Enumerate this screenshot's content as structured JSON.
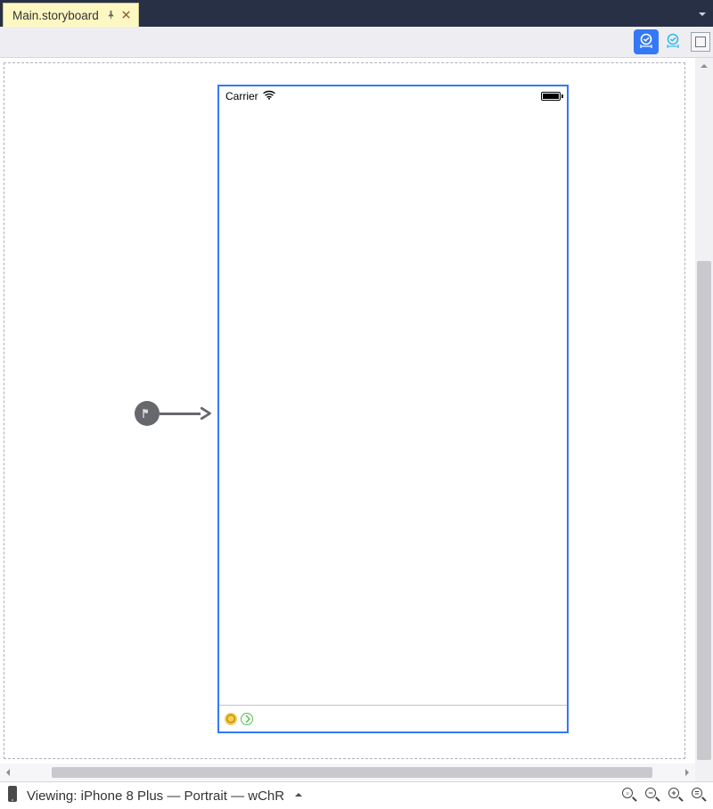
{
  "tab": {
    "title": "Main.storyboard"
  },
  "statusbar": {
    "carrier": "Carrier"
  },
  "footer": {
    "prefix": "Viewing:",
    "device": "iPhone 8 Plus",
    "orientation": "Portrait",
    "size_class": "wChR"
  },
  "icons": {
    "pin": "pin-icon",
    "close": "close-icon",
    "wifi": "wifi-icon",
    "battery": "battery-icon",
    "flag": "flag-icon",
    "phone": "phone-icon"
  }
}
